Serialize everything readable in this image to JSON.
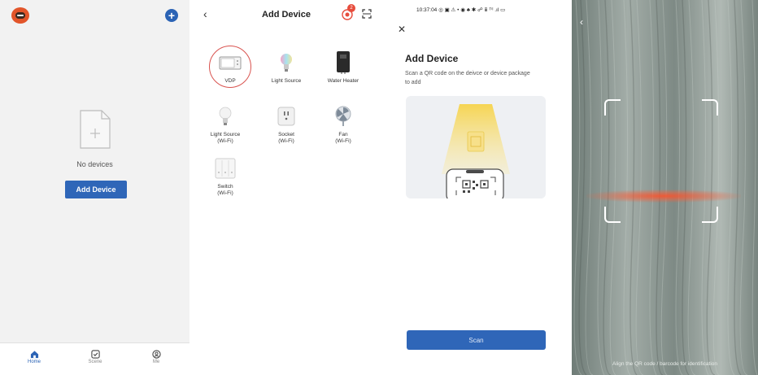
{
  "home": {
    "empty_text": "No devices",
    "add_button": "Add Device",
    "tabs": [
      {
        "label": "Home",
        "icon": "home-icon",
        "active": true
      },
      {
        "label": "Scene",
        "icon": "checkbox-icon",
        "active": false
      },
      {
        "label": "Me",
        "icon": "user-icon",
        "active": false
      }
    ],
    "accent": "#2f66b8"
  },
  "device_list": {
    "title": "Add Device",
    "badge_count": "2",
    "devices": [
      {
        "name": "VDP",
        "sub": ""
      },
      {
        "name": "Light Source",
        "sub": ""
      },
      {
        "name": "Water Heater",
        "sub": ""
      },
      {
        "name": "Light Source",
        "sub": "(Wi-Fi)"
      },
      {
        "name": "Socket",
        "sub": "(Wi-Fi)"
      },
      {
        "name": "Fan",
        "sub": "(Wi-Fi)"
      },
      {
        "name": "Switch",
        "sub": "(Wi-Fi)"
      }
    ]
  },
  "qr_intro": {
    "status_time": "10:37:04",
    "status_icons": "◎ ▣ ⚠ • ◉ ♣ ✱ ☍ ⅲ ᵀⁱˡ .ıl ▭",
    "title": "Add Device",
    "description": "Scan a QR code on the deivce or device package to add",
    "scan_button": "Scan"
  },
  "camera": {
    "hint": "Align the QR code / barcode for identification"
  }
}
